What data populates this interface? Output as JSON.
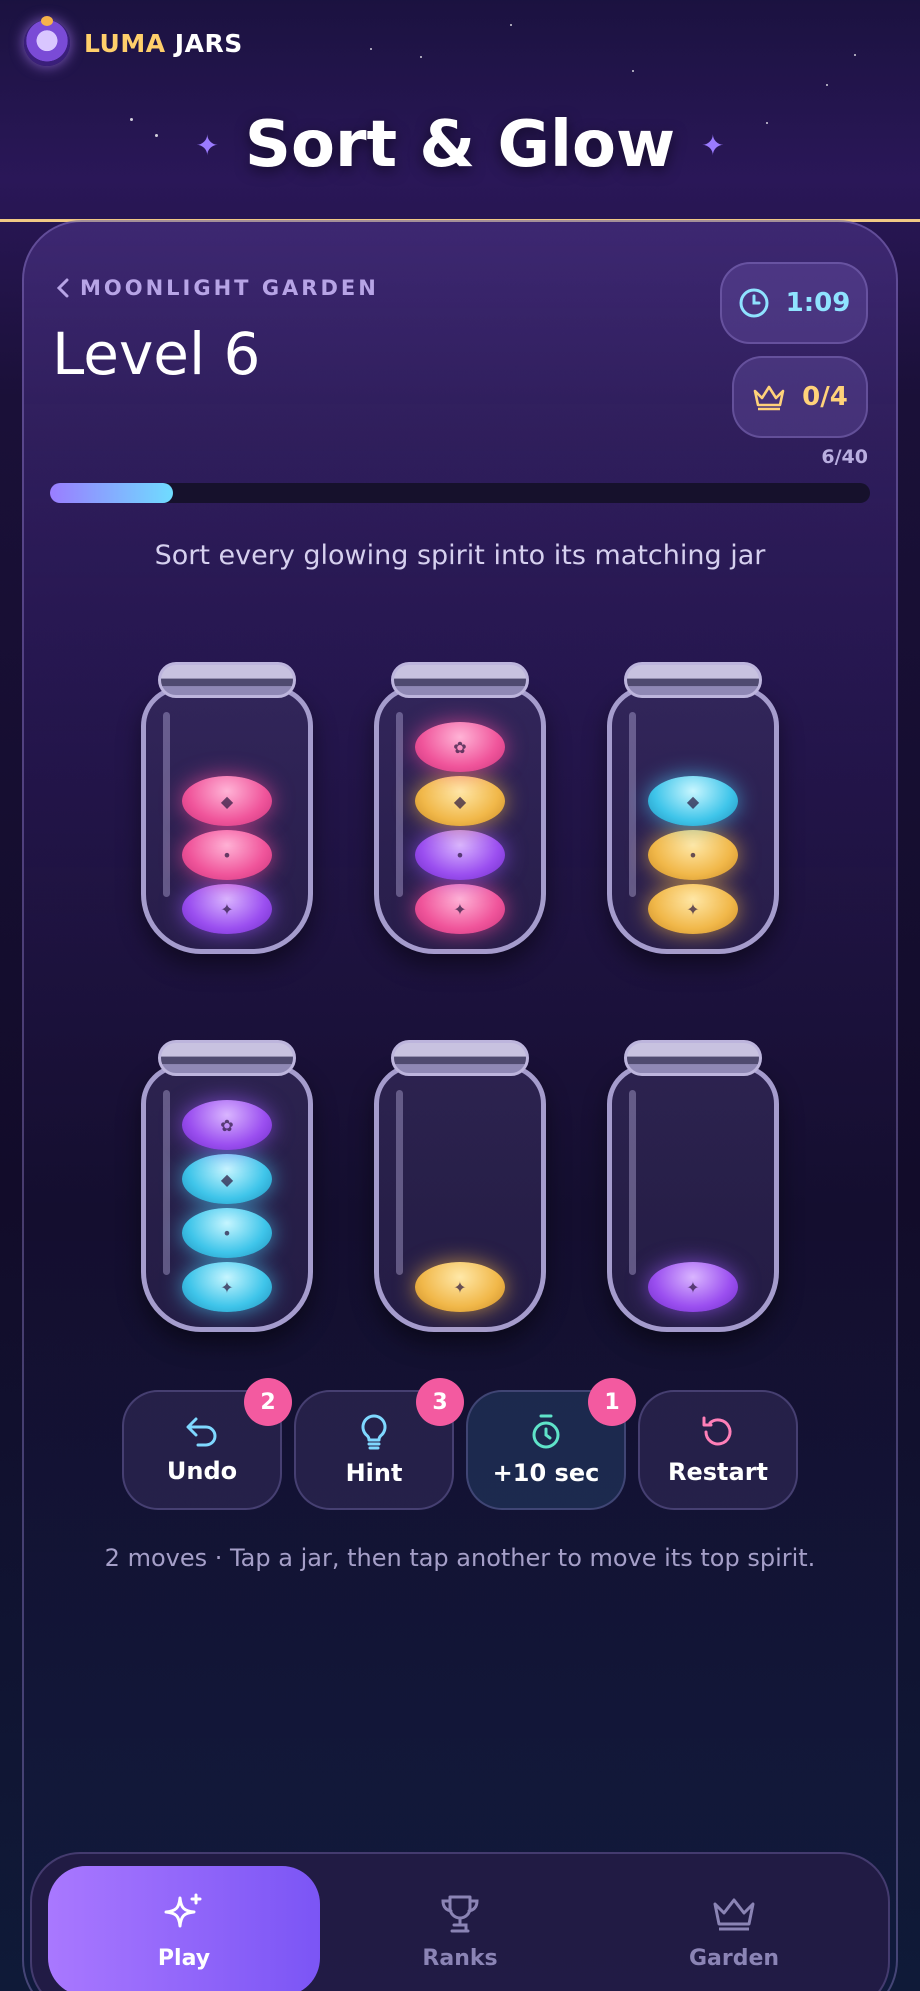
{
  "brand": {
    "name_a": "LUMA",
    "name_b": "JARS"
  },
  "title": "Sort & Glow",
  "breadcrumb": "MOONLIGHT GARDEN",
  "level_title": "Level 6",
  "timer": "1:09",
  "crowns": "0/4",
  "progress": {
    "label": "6/40",
    "fraction": 0.15
  },
  "instruction": "Sort every glowing spirit into its matching jar",
  "jars": [
    {
      "spirits": [
        "purple",
        "pink",
        "pink"
      ]
    },
    {
      "spirits": [
        "pink",
        "purple",
        "gold",
        "pink"
      ]
    },
    {
      "spirits": [
        "gold",
        "gold",
        "cyan"
      ]
    },
    {
      "spirits": [
        "cyan",
        "cyan",
        "cyan",
        "purple"
      ]
    },
    {
      "spirits": [
        "gold"
      ]
    },
    {
      "spirits": [
        "purple"
      ]
    }
  ],
  "actions": {
    "undo": {
      "label": "Undo",
      "badge": "2"
    },
    "hint": {
      "label": "Hint",
      "badge": "3"
    },
    "time": {
      "label": "+10 sec",
      "badge": "1"
    },
    "restart": {
      "label": "Restart"
    }
  },
  "status": "2 moves · Tap a jar, then tap another to move its top spirit.",
  "nav": {
    "play": "Play",
    "ranks": "Ranks",
    "garden": "Garden"
  },
  "colors": {
    "pink": "#f0559b",
    "purple": "#9b4ff0",
    "gold": "#f1b84a",
    "cyan": "#3fc5ea",
    "accent": "#8b6bff"
  }
}
